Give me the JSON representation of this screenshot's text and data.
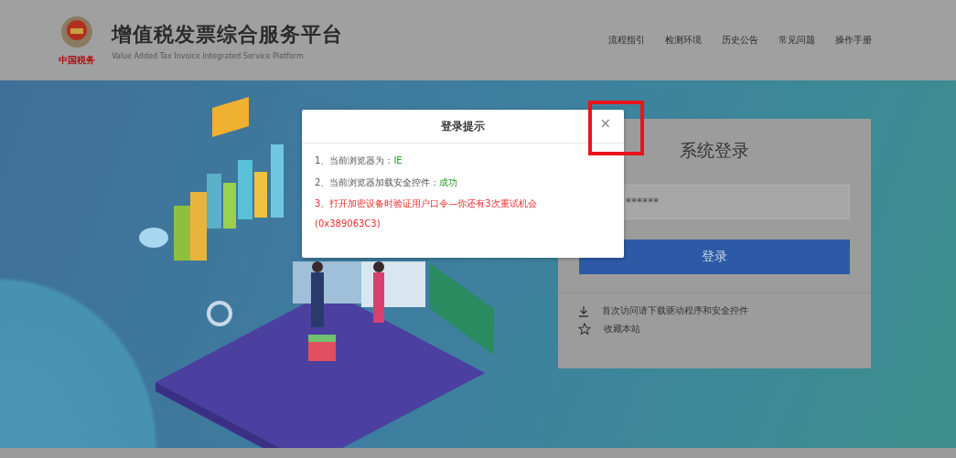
{
  "header": {
    "logo_text": "中国税务",
    "title": "增值税发票综合服务平台",
    "subtitle": "Value Added Tax Invoice Integrated Service Platform",
    "nav": [
      "流程指引",
      "检测环境",
      "历史公告",
      "常见问题",
      "操作手册"
    ]
  },
  "login": {
    "title": "系统登录",
    "password": "******",
    "button": "登录",
    "links": [
      {
        "kind": "download",
        "text": "首次访问请下载驱动程序和安全控件"
      },
      {
        "kind": "favorite",
        "text": "收藏本站"
      }
    ]
  },
  "dialog": {
    "title": "登录提示",
    "close": "×",
    "highlight_close": true,
    "messages": [
      {
        "kind": "status",
        "label": "1、当前浏览器为：",
        "value": "IE"
      },
      {
        "kind": "status",
        "label": "2、当前浏览器加载安全控件：",
        "value": "成功"
      },
      {
        "kind": "error",
        "text": "3、打开加密设备时验证用户口令—你还有3次重试机会(0x389063C3)"
      }
    ]
  }
}
